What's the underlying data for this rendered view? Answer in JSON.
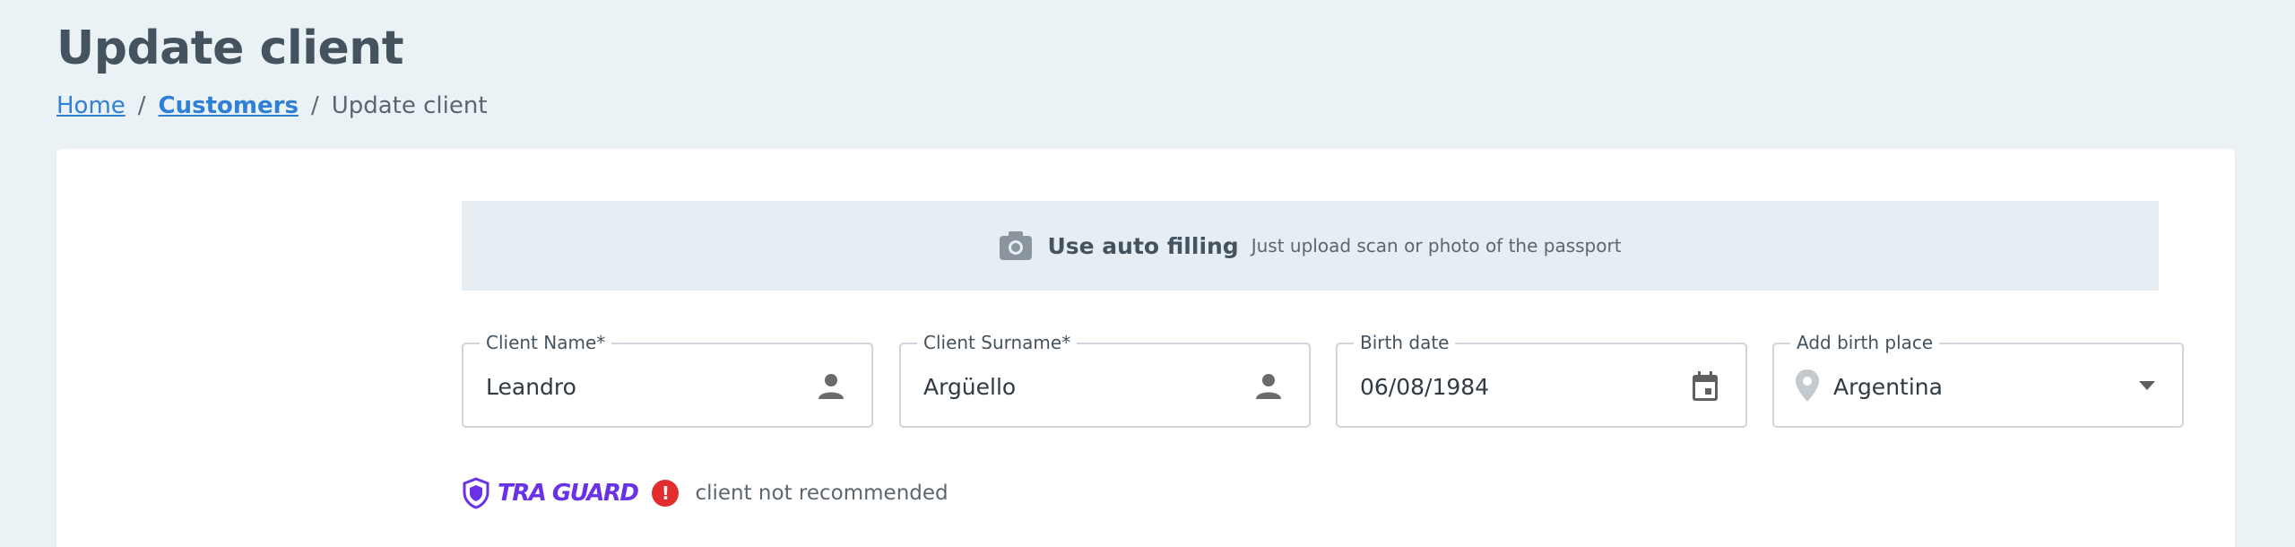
{
  "page": {
    "title": "Update client"
  },
  "breadcrumb": {
    "home": "Home",
    "separator": "/",
    "customers": "Customers",
    "current": "Update client"
  },
  "autofill": {
    "icon": "camera-icon",
    "title": "Use auto filling",
    "subtitle": "Just upload scan or photo of the passport"
  },
  "fields": {
    "client_name": {
      "label": "Client Name*",
      "value": "Leandro",
      "icon": "person-icon"
    },
    "client_surname": {
      "label": "Client Surname*",
      "value": "Argüello",
      "icon": "person-icon"
    },
    "birth_date": {
      "label": "Birth date",
      "value": "06/08/1984",
      "icon": "calendar-icon"
    },
    "birth_place": {
      "label": "Add birth place",
      "value": "Argentina",
      "icon": "location-pin-icon",
      "dropdown_icon": "caret-down-icon"
    }
  },
  "guard": {
    "logo_text": "TRA GUARD",
    "alert_symbol": "!",
    "message": "client not recommended"
  },
  "colors": {
    "background": "#ebf2f6",
    "link": "#2f7fd6",
    "brand": "#6a32e6",
    "alert": "#e12d2d"
  }
}
